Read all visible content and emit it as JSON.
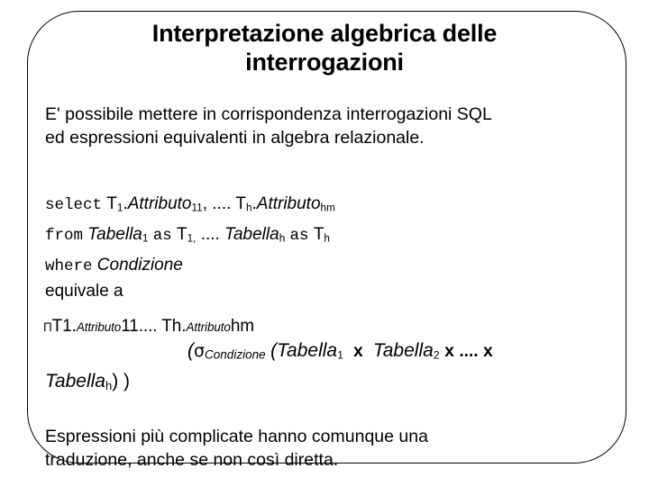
{
  "slide": {
    "title": "Interpretazione algebrica delle interrogazioni",
    "title_line1": "Interpretazione algebrica delle",
    "title_line2": "interrogazioni",
    "background_color": "#ffffff",
    "text_color": "#000000",
    "border_color": "#000000"
  },
  "intro": {
    "line1": "E' possibile mettere in corrispondenza interrogazioni SQL",
    "line2": "ed espressioni equivalenti in algebra relazionale."
  },
  "sql": {
    "select_keyword": "select",
    "select_t1": "T",
    "select_t1_sub": "1",
    "select_dot1": ".",
    "select_attr1": "Attributo",
    "select_attr1_sub": "11",
    "select_comma_ellipsis": ", .... ",
    "select_th": "T",
    "select_th_sub": "h",
    "select_dot2": ".",
    "select_attrh": "Attributo",
    "select_attrh_sub": "hm",
    "from_keyword": "from",
    "from_tab1": "Tabella",
    "from_tab1_sub": "1",
    "from_as1": "as",
    "from_t1": "T",
    "from_t1_sub": "1,",
    "from_ellipsis": " .... ",
    "from_tabh": "Tabella",
    "from_tabh_sub": "h",
    "from_as2": "as",
    "from_th": "T",
    "from_th_sub": "h",
    "where_keyword": "where",
    "where_condition": "Condizione"
  },
  "equivale": "equivale a",
  "algebra": {
    "proj_symbol": "Π",
    "proj_t1": "T1.",
    "proj_attr1": "Attributo",
    "proj_attr1_sub": "11",
    "proj_sep": ".... ",
    "proj_th": "Th.",
    "proj_attrh": "Attributo",
    "proj_attrh_sub": "hm",
    "open_paren": "(",
    "sigma_symbol": "σ",
    "sigma_subscript": "Condizione",
    "inner_open_paren": "(",
    "tab1": "Tabella",
    "tab1_sub": "1",
    "cross1": "x",
    "tab2": "Tabella",
    "tab2_sub": "2",
    "cross2": "x",
    "ellipsis": "....",
    "cross3": "x",
    "tabh": "Tabella",
    "tabh_sub": "h",
    "close_parens": ") )"
  },
  "outro": {
    "line1": "Espressioni più complicate hanno comunque una",
    "line2": "traduzione, anche se non così diretta."
  }
}
